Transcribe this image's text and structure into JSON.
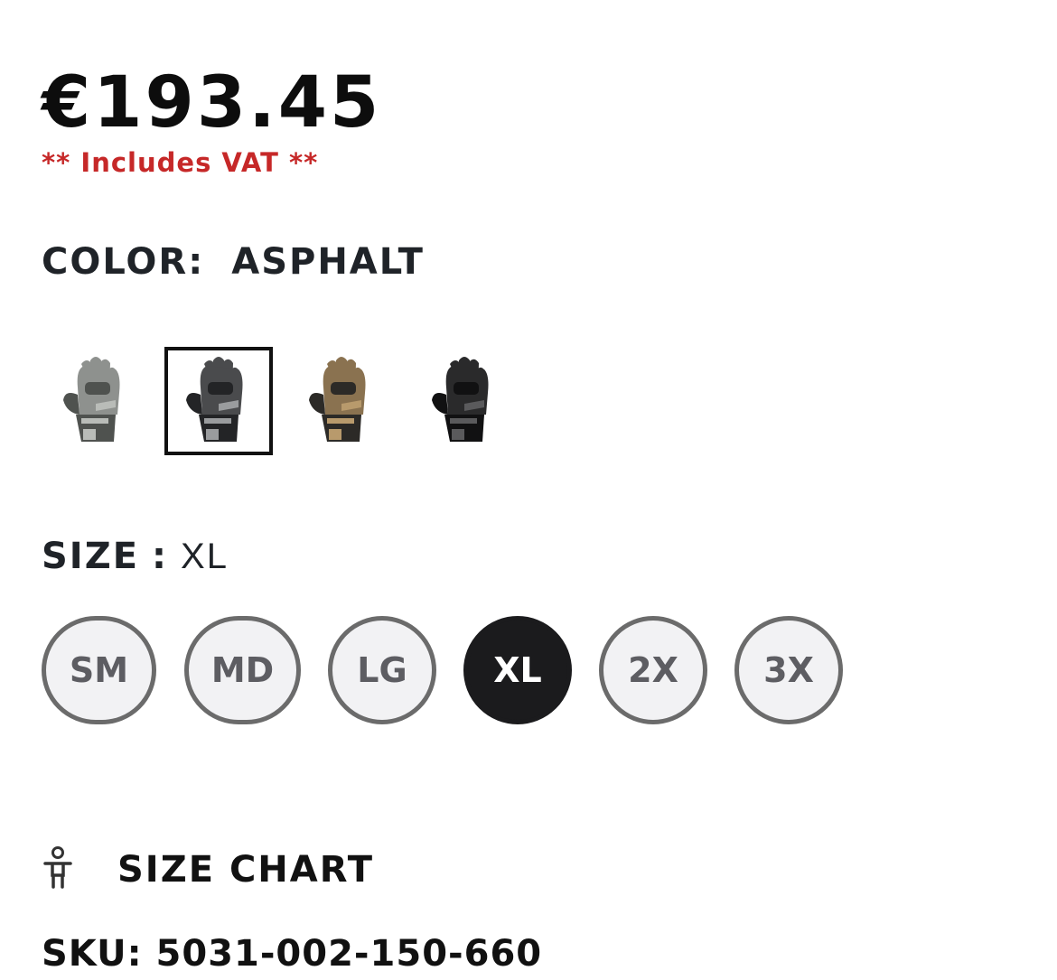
{
  "price": "€193.45",
  "vat_note": "** Includes VAT **",
  "color": {
    "label": "COLOR:",
    "value": "ASPHALT",
    "swatches": [
      {
        "name": "gray",
        "selected": false,
        "base": "#8e918e",
        "dark": "#4f524f",
        "accent": "#b9bcb8"
      },
      {
        "name": "asphalt",
        "selected": true,
        "base": "#4a4b4d",
        "dark": "#232426",
        "accent": "#9a9c9e"
      },
      {
        "name": "tan",
        "selected": false,
        "base": "#8a7250",
        "dark": "#2c2a27",
        "accent": "#b89a6c"
      },
      {
        "name": "black",
        "selected": false,
        "base": "#2a2a2b",
        "dark": "#111112",
        "accent": "#5a5a5c"
      }
    ]
  },
  "size": {
    "label": "SIZE",
    "separator": ":",
    "value": "XL",
    "options": [
      "SM",
      "MD",
      "LG",
      "XL",
      "2X",
      "3X"
    ],
    "selected": "XL"
  },
  "size_chart": {
    "label": "SIZE CHART",
    "icon": "person-icon"
  },
  "sku": "SKU: 5031-002-150-660"
}
